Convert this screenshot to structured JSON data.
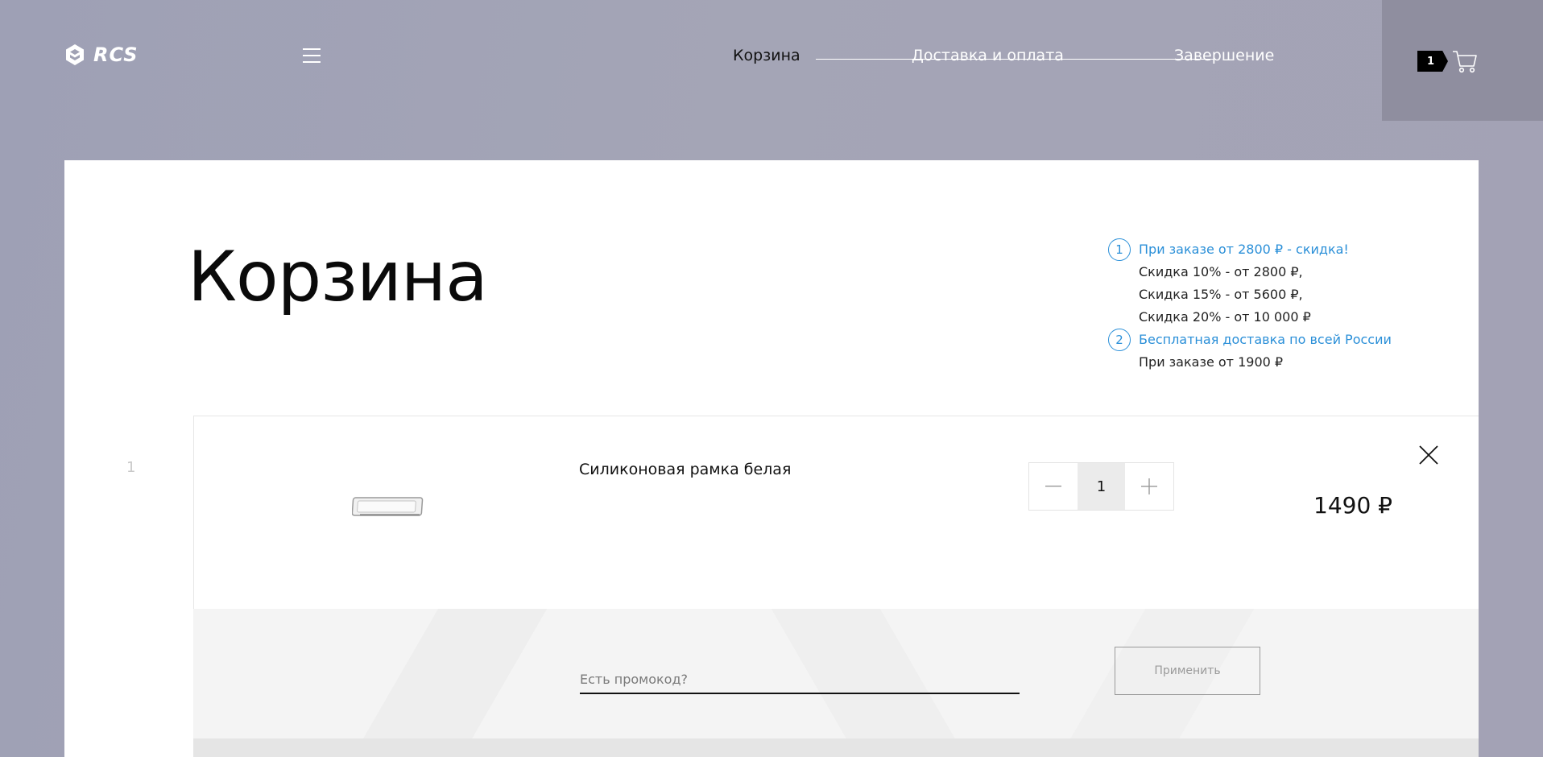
{
  "header": {
    "logo_text": "RCS",
    "steps": [
      "Корзина",
      "Доставка и оплата",
      "Завершение"
    ],
    "cart_count": "1"
  },
  "main": {
    "title": "Корзина",
    "promo": {
      "item1_number": "1",
      "item1_title": "При заказе от 2800 ₽ - скидка!",
      "item1_lines": [
        "Скидка 10% - от 2800 ₽,",
        "Скидка 15% - от 5600 ₽,",
        "Скидка 20% - от 10 000 ₽"
      ],
      "item2_number": "2",
      "item2_title": "Бесплатная доставка по всей России",
      "item2_line": "При заказе от 1900 ₽"
    },
    "items": [
      {
        "index": "1",
        "name": "Силиконовая рамка белая",
        "quantity": "1",
        "price": "1490 ₽"
      }
    ],
    "promocode": {
      "placeholder": "Есть промокод?",
      "apply_label": "Применить"
    }
  },
  "icons": {
    "logo": "rcs-logo-icon",
    "menu": "hamburger-menu-icon",
    "cart": "shopping-cart-icon",
    "remove": "close-icon",
    "minus": "minus-icon",
    "plus": "plus-icon"
  },
  "colors": {
    "accent": "#2a8fd8",
    "background": "#a2a2b4",
    "cart_box": "#8f8e9f"
  }
}
